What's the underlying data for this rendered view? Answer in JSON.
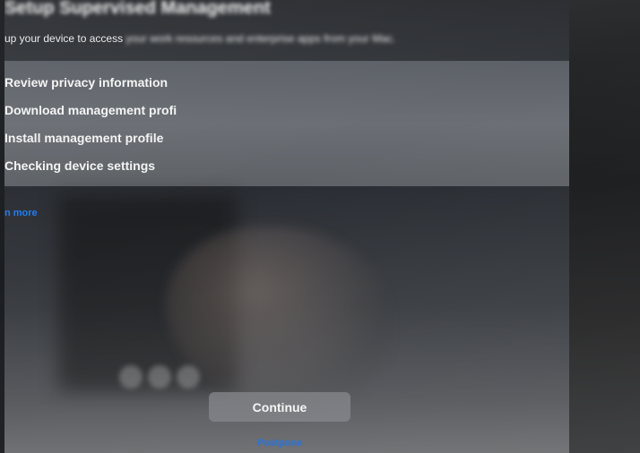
{
  "header": {
    "title": "Setup Supervised Management",
    "subtitle_visible": "up your device to access",
    "subtitle_blurred": "your work resources and enterprise apps from your Mac."
  },
  "steps": [
    {
      "label": "Review privacy information"
    },
    {
      "label": "Download management profi"
    },
    {
      "label": "Install management profile"
    },
    {
      "label": "Checking device settings"
    }
  ],
  "links": {
    "learn_more": "n more",
    "postpone": "Postpone"
  },
  "buttons": {
    "continue": "Continue"
  },
  "colors": {
    "accent": "#1e7cf2",
    "button": "#828488"
  }
}
